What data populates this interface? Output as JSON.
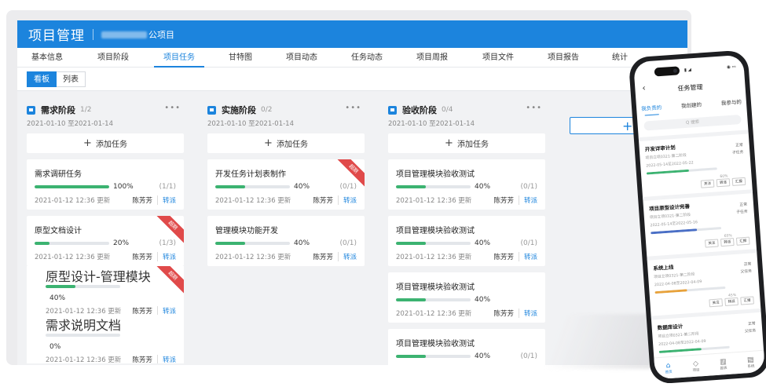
{
  "app": {
    "title": "项目管理",
    "project_suffix": "公项目"
  },
  "tabs": [
    {
      "label": "基本信息"
    },
    {
      "label": "项目阶段"
    },
    {
      "label": "项目任务"
    },
    {
      "label": "甘特图"
    },
    {
      "label": "项目动态"
    },
    {
      "label": "任务动态"
    },
    {
      "label": "项目周报"
    },
    {
      "label": "项目文件"
    },
    {
      "label": "项目报告"
    },
    {
      "label": "统计"
    }
  ],
  "active_tab_index": 2,
  "views": [
    {
      "label": "看板"
    },
    {
      "label": "列表"
    }
  ],
  "board": {
    "add_task_label": "添加任务",
    "add_column_icon": "plus-icon",
    "columns": [
      {
        "name": "需求阶段",
        "count": "1/2",
        "date_range": "2021-01-10 至2021-01-14",
        "cards": [
          {
            "title": "需求调研任务",
            "progress": 1.0,
            "percent": "100%",
            "ratio": "(1/1)",
            "updated": "2021-01-12  12:36 更新",
            "owner": "陈芳芳",
            "reassign": "转派",
            "overdue": false,
            "sub": false
          },
          {
            "title": "原型文档设计",
            "progress": 0.2,
            "percent": "20%",
            "ratio": "(1/3)",
            "updated": "2021-01-12  12:36 更新",
            "owner": "陈芳芳",
            "reassign": "转派",
            "overdue": true,
            "sub": false
          },
          {
            "title": "原型设计-管理模块",
            "progress": 0.4,
            "percent": "40%",
            "ratio": "",
            "updated": "2021-01-12  12:36 更新",
            "owner": "陈芳芳",
            "reassign": "转派",
            "overdue": true,
            "sub": true
          },
          {
            "title": "需求说明文档",
            "progress": 0.0,
            "percent": "0%",
            "ratio": "",
            "updated": "2021-01-12  12:36 更新",
            "owner": "陈芳芳",
            "reassign": "转派",
            "overdue": false,
            "sub": true
          }
        ]
      },
      {
        "name": "实施阶段",
        "count": "0/2",
        "date_range": "2021-01-10 至2021-01-14",
        "cards": [
          {
            "title": "开发任务计划表制作",
            "progress": 0.4,
            "percent": "40%",
            "ratio": "(0/1)",
            "updated": "2021-01-12  12:36 更新",
            "owner": "陈芳芳",
            "reassign": "转派",
            "overdue": true,
            "sub": false
          },
          {
            "title": "管理模块功能开发",
            "progress": 0.4,
            "percent": "40%",
            "ratio": "(0/1)",
            "updated": "2021-01-12  12:36 更新",
            "owner": "陈芳芳",
            "reassign": "转派",
            "overdue": false,
            "sub": false
          }
        ]
      },
      {
        "name": "验收阶段",
        "count": "0/4",
        "date_range": "2021-01-10 至2021-01-14",
        "cards": [
          {
            "title": "项目管理模块验收测试",
            "progress": 0.4,
            "percent": "40%",
            "ratio": "(0/1)",
            "updated": "2021-01-12  12:36 更新",
            "owner": "陈芳芳",
            "reassign": "转派",
            "overdue": false,
            "sub": false
          },
          {
            "title": "项目管理模块验收测试",
            "progress": 0.4,
            "percent": "40%",
            "ratio": "(0/1)",
            "updated": "2021-01-12  12:36 更新",
            "owner": "陈芳芳",
            "reassign": "转派",
            "overdue": false,
            "sub": false
          },
          {
            "title": "项目管理模块验收测试",
            "progress": 0.4,
            "percent": "40%",
            "ratio": "",
            "updated": "2021-01-12  12:36 更新",
            "owner": "陈芳芳",
            "reassign": "转派",
            "overdue": false,
            "sub": false
          },
          {
            "title": "项目管理模块验收测试",
            "progress": 0.4,
            "percent": "40%",
            "ratio": "(0/1)",
            "updated": "",
            "owner": "",
            "reassign": "",
            "overdue": false,
            "sub": false
          }
        ]
      }
    ],
    "overdue_label": "超期"
  },
  "phone": {
    "title": "任务管理",
    "tabs": [
      {
        "label": "我负责的"
      },
      {
        "label": "我创建的"
      },
      {
        "label": "我参与的"
      }
    ],
    "search_placeholder": "Q 搜索",
    "tasks": [
      {
        "title": "开发详审计划",
        "project": "项目立项0321-第二阶段",
        "dates": "2022-05-14至2022-05-22",
        "status": "正常",
        "role": "子任务",
        "progress": 0.6,
        "percent": "60%",
        "color": "#3cb371",
        "actions": [
          "关注",
          "转派",
          "汇报"
        ]
      },
      {
        "title": "项目原型设计完善",
        "project": "项目立项0321-第二阶段",
        "dates": "2022-05-14至2022-05-16",
        "status": "正常",
        "role": "子任务",
        "progress": 0.65,
        "percent": "65%",
        "color": "#4a6fc6",
        "actions": [
          "关注",
          "转派",
          "汇报"
        ]
      },
      {
        "title": "系统上线",
        "project": "项目立项0321-第二阶段",
        "dates": "2022-04-08至2022-04-09",
        "status": "正常",
        "role": "父任务",
        "progress": 0.45,
        "percent": "45%",
        "color": "#e8a23a",
        "actions": [
          "关注",
          "转派",
          "汇报"
        ]
      },
      {
        "title": "数据库设计",
        "project": "项目立项0321-第二阶段",
        "dates": "2022-04-08至2022-04-09",
        "status": "正常",
        "role": "父任务",
        "progress": 0.6,
        "percent": "60%",
        "color": "#3cb371",
        "actions": []
      }
    ],
    "nav": [
      {
        "label": "首页",
        "icon": "home-icon"
      },
      {
        "label": "项目",
        "icon": "project-icon"
      },
      {
        "label": "报表",
        "icon": "report-icon"
      },
      {
        "label": "系统",
        "icon": "system-icon"
      }
    ]
  }
}
